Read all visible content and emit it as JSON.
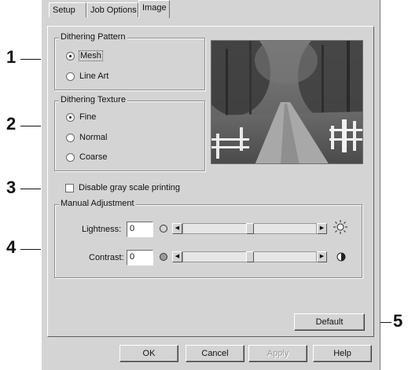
{
  "tabs": [
    {
      "label": "Setup",
      "active": false
    },
    {
      "label": "Job Options",
      "active": false
    },
    {
      "label": "Image",
      "active": true
    }
  ],
  "dithering_pattern": {
    "title": "Dithering Pattern",
    "options": [
      {
        "label": "Mesh",
        "selected": true
      },
      {
        "label": "Line Art",
        "selected": false
      }
    ]
  },
  "dithering_texture": {
    "title": "Dithering Texture",
    "options": [
      {
        "label": "Fine",
        "selected": true
      },
      {
        "label": "Normal",
        "selected": false
      },
      {
        "label": "Coarse",
        "selected": false
      }
    ]
  },
  "grayscale": {
    "label": "Disable gray scale printing",
    "checked": false
  },
  "manual_adjustment": {
    "title": "Manual Adjustment",
    "lightness": {
      "label": "Lightness:",
      "value": "0",
      "level": 0.5
    },
    "contrast": {
      "label": "Contrast:",
      "value": "0",
      "level": 0.5
    }
  },
  "buttons": {
    "default": "Default",
    "ok": "OK",
    "cancel": "Cancel",
    "apply": "Apply",
    "help": "Help"
  },
  "callouts": [
    "1",
    "2",
    "3",
    "4",
    "5"
  ],
  "colors": {
    "dialog_bg": "#d4d4d4",
    "accent": "#111111"
  }
}
